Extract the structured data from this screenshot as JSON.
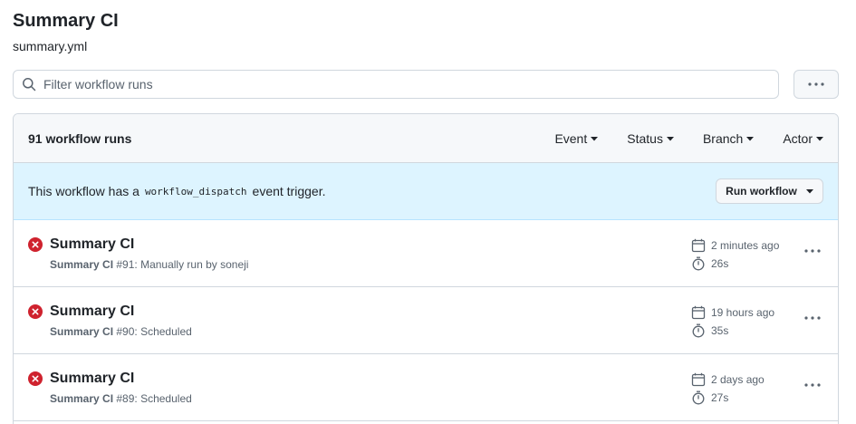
{
  "workflow": {
    "title": "Summary CI",
    "file": "summary.yml"
  },
  "search": {
    "placeholder": "Filter workflow runs",
    "value": ""
  },
  "list": {
    "count_label": "91 workflow runs",
    "filters": {
      "event": "Event",
      "status": "Status",
      "branch": "Branch",
      "actor": "Actor"
    }
  },
  "banner": {
    "text_before": "This workflow has a",
    "code": "workflow_dispatch",
    "text_after": "event trigger.",
    "button": "Run workflow"
  },
  "runs": [
    {
      "title": "Summary CI",
      "workflow": "Summary CI",
      "number": "#91",
      "detail": ": Manually run by soneji",
      "time": "2 minutes ago",
      "duration": "26s",
      "status": "failure"
    },
    {
      "title": "Summary CI",
      "workflow": "Summary CI",
      "number": "#90",
      "detail": ": Scheduled",
      "time": "19 hours ago",
      "duration": "35s",
      "status": "failure"
    },
    {
      "title": "Summary CI",
      "workflow": "Summary CI",
      "number": "#89",
      "detail": ": Scheduled",
      "time": "2 days ago",
      "duration": "27s",
      "status": "failure"
    }
  ],
  "icons": {
    "search": "search-icon",
    "kebab": "kebab-horizontal-icon",
    "caret": "triangle-down-icon",
    "failure": "x-circle-fill-icon",
    "calendar": "calendar-icon",
    "stopwatch": "stopwatch-icon"
  },
  "colors": {
    "failure": "#cf222e",
    "banner_bg": "#ddf4ff",
    "muted_text": "#59636e"
  }
}
